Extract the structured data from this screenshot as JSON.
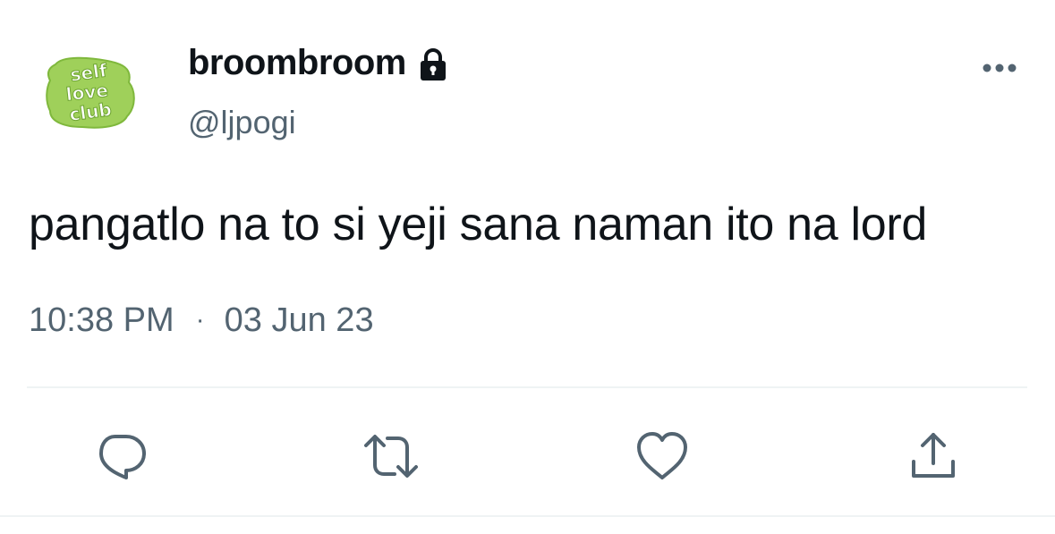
{
  "author": {
    "display_name": "broombroom",
    "handle": "@ljpogi",
    "protected": true,
    "avatar_text": "self love club",
    "avatar_color": "#9fd05a"
  },
  "tweet": {
    "text": "pangatlo na to si yeji sana naman ito na lord",
    "time": "10:38 PM",
    "separator": "·",
    "date": "03 Jun 23"
  },
  "actions": {
    "reply_icon": "reply-icon",
    "retweet_icon": "retweet-icon",
    "like_icon": "like-icon",
    "share_icon": "share-icon",
    "more_icon": "more-icon"
  },
  "colors": {
    "text_primary": "#0f1419",
    "text_secondary": "#536471",
    "divider": "#eff3f4"
  }
}
